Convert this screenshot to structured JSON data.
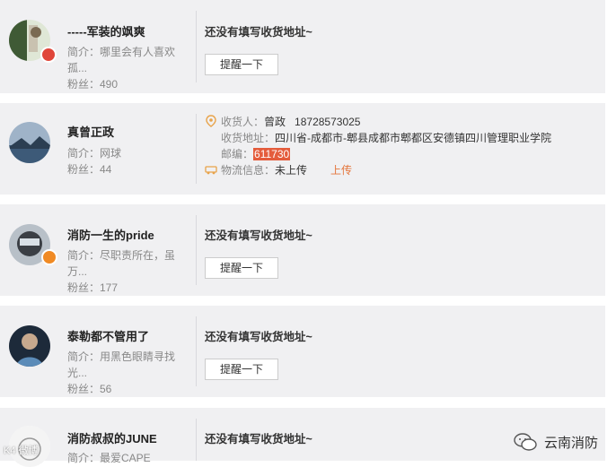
{
  "cards": [
    {
      "name": "-----军装的飒爽",
      "intro": "简介：哪里会有人喜欢孤...",
      "fans": "粉丝：490",
      "has_address": false,
      "no_address_text": "还没有填写收货地址~",
      "remind_label": "提醒一下"
    },
    {
      "name": "真曾正政",
      "intro": "简介：网球",
      "fans": "粉丝：44",
      "has_address": true,
      "receiver_label": "收货人：",
      "receiver": "曾政",
      "phone": "18728573025",
      "address_label": "收货地址：",
      "address": "四川省-成都市-郫县成都市郫都区安德镇四川管理职业学院",
      "postcode_label": "邮编：",
      "postcode": "611730",
      "logistics_label": "物流信息：",
      "logistics": "未上传",
      "upload_label": "上传"
    },
    {
      "name": "消防一生的pride",
      "intro": "简介：尽职责所在，虽万...",
      "fans": "粉丝：177",
      "has_address": false,
      "no_address_text": "还没有填写收货地址~",
      "remind_label": "提醒一下"
    },
    {
      "name": "泰勒都不管用了",
      "intro": "简介：用黑色眼睛寻找光...",
      "fans": "粉丝：56",
      "has_address": false,
      "no_address_text": "还没有填写收货地址~",
      "remind_label": "提醒一下"
    },
    {
      "name": "消防叔叔的JUNE",
      "intro": "简介：最爱CAPE",
      "has_address": false,
      "no_address_text": "还没有填写收货地址~"
    }
  ],
  "watermark": {
    "text": "云南消防",
    "left_text": "K4 微博"
  },
  "colors": {
    "card_bg": "#f0f0f2",
    "highlight": "#e45c3c",
    "upload": "#e4763c"
  }
}
